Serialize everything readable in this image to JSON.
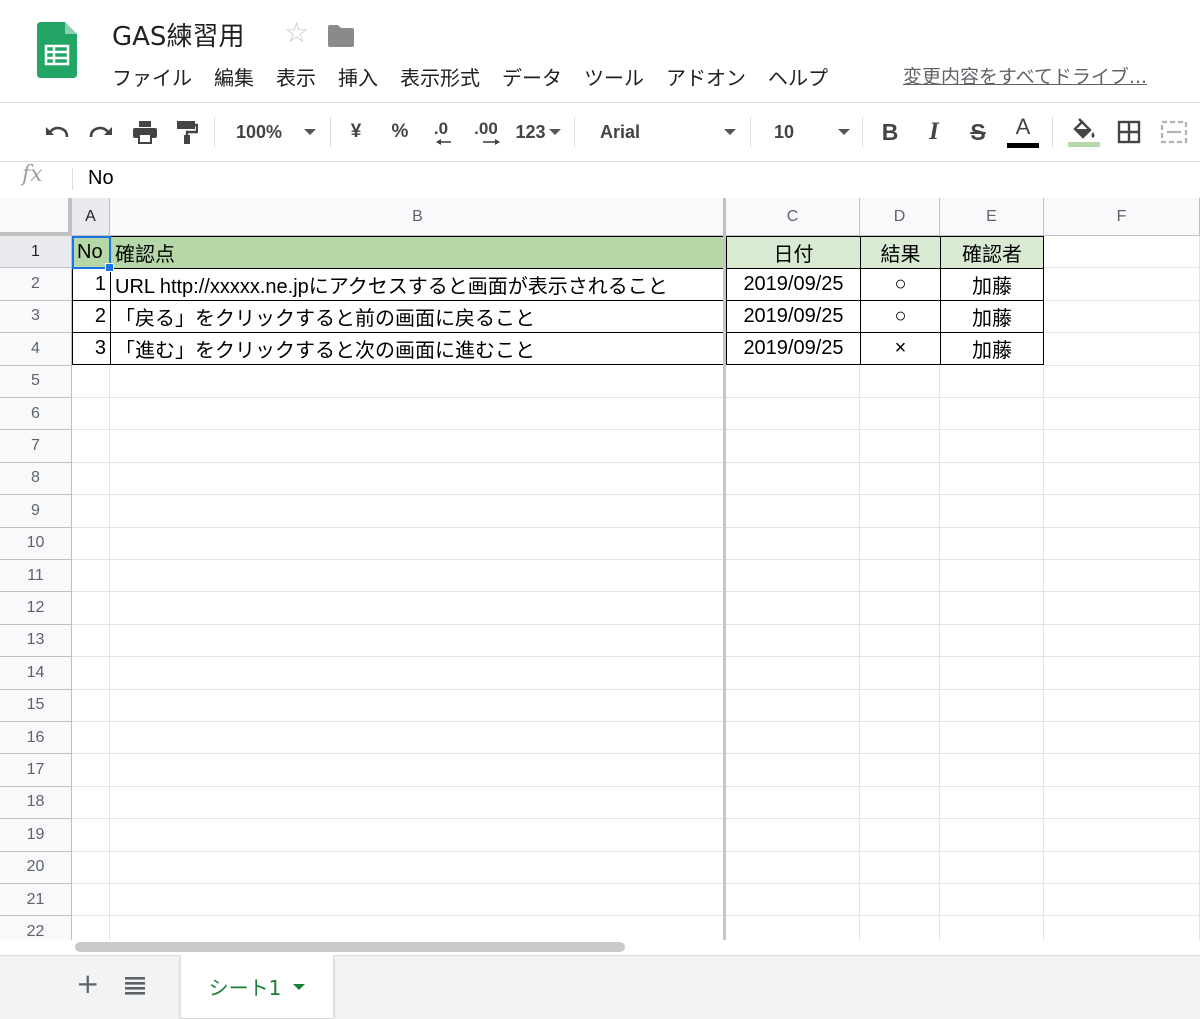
{
  "app": {
    "doc_title": "GAS練習用",
    "last_edit": "変更内容をすべてドライブ..."
  },
  "menu": [
    "ファイル",
    "編集",
    "表示",
    "挿入",
    "表示形式",
    "データ",
    "ツール",
    "アドオン",
    "ヘルプ"
  ],
  "toolbar": {
    "zoom": "100%",
    "currency": "¥",
    "percent": "%",
    "decrease_decimal": ".0",
    "increase_decimal": ".00",
    "more_formats": "123",
    "font": "Arial",
    "font_size": "10",
    "bold": "B",
    "italic": "I",
    "strike": "S",
    "text_color_label": "A",
    "text_color": "#000000",
    "fill_color": "#b6d7a8"
  },
  "formula_bar": {
    "fx": "fx",
    "value": "No"
  },
  "grid": {
    "columns": [
      "A",
      "B",
      "C",
      "D",
      "E",
      "F"
    ],
    "rows": [
      "1",
      "2",
      "3",
      "4",
      "5",
      "6",
      "7",
      "8",
      "9",
      "10",
      "11",
      "12",
      "13",
      "14",
      "15",
      "16",
      "17",
      "18",
      "19",
      "20",
      "21",
      "22"
    ],
    "cells": [
      [
        "No",
        "確認点",
        "日付",
        "結果",
        "確認者"
      ],
      [
        "1",
        "URL http://xxxxx.ne.jpにアクセスすると画面が表示されること",
        "2019/09/25",
        "○",
        "加藤"
      ],
      [
        "2",
        "「戻る」をクリックすると前の画面に戻ること",
        "2019/09/25",
        "○",
        "加藤"
      ],
      [
        "3",
        "「進む」をクリックすると次の画面に進むこと",
        "2019/09/25",
        "×",
        "加藤"
      ]
    ],
    "header_fill": "#b6d7a8",
    "header_fill_light": "#d9ead3",
    "selection_color": "#1a73e8"
  },
  "sheets": {
    "active_tab": "シート1",
    "tab_color": "#188038"
  }
}
